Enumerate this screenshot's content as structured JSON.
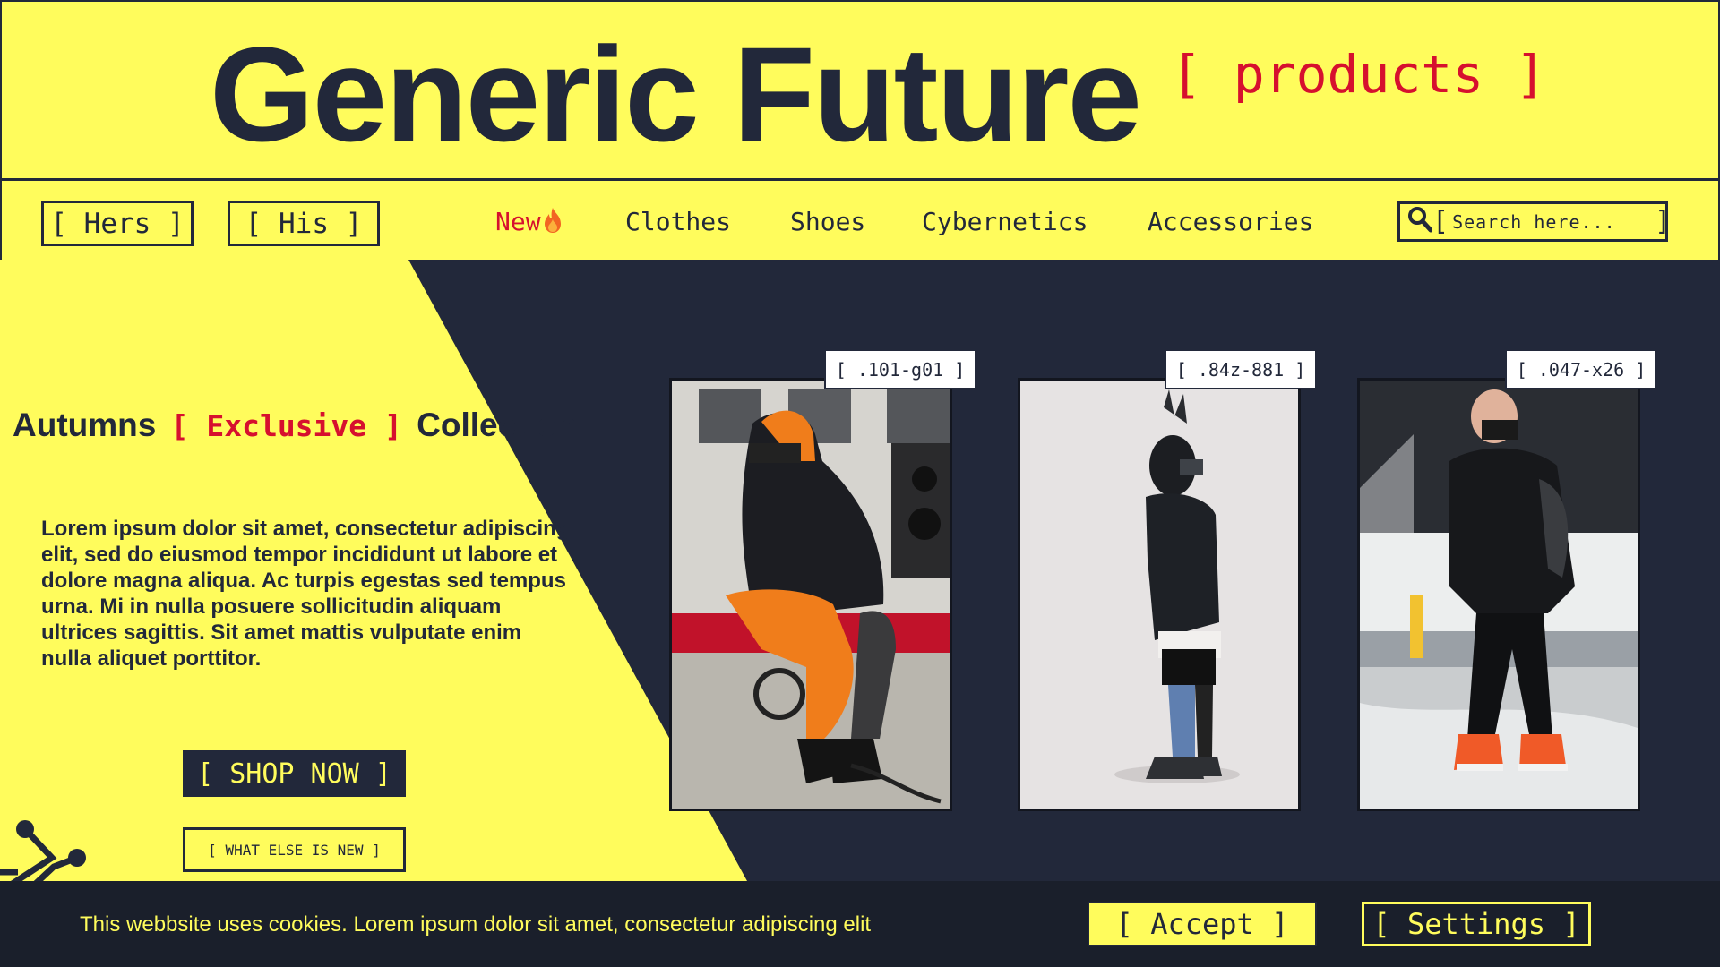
{
  "colors": {
    "accent_yellow": "#fffc5c",
    "navy": "#22283a",
    "red": "#d6102e",
    "cookie_bg": "#1a1f2b"
  },
  "header": {
    "title": "Generic Future",
    "tag": "[ products ]"
  },
  "nav": {
    "hers": "[ Hers ]",
    "his": "[ His ]",
    "links": [
      "New",
      "Clothes",
      "Shoes",
      "Cybernetics",
      "Accessories"
    ],
    "new_icon": "fire-icon",
    "search_icon": "search-icon",
    "search_open": "[",
    "search_close": "]",
    "search_placeholder": "Search here..."
  },
  "hero": {
    "title_pre": "Autumns",
    "title_tag": "[ Exclusive ]",
    "title_post": "Collection",
    "text": "Lorem ipsum dolor sit amet, consectetur adipiscing elit, sed do eiusmod tempor incididunt ut labore et dolore magna aliqua. Ac turpis egestas sed tempus urna. Mi in nulla posuere sollicitudin aliquam ultrices sagittis. Sit amet mattis vulputate enim nulla aliquet porttitor.",
    "shop_now": "[ SHOP NOW ]",
    "what_else": "[ WHAT ELSE IS NEW ]"
  },
  "products": [
    {
      "sku": "[ .101-g01 ]"
    },
    {
      "sku": "[ .84z-881 ]"
    },
    {
      "sku": "[ .047-x26 ]"
    }
  ],
  "cookie": {
    "text": "This webbsite uses cookies. Lorem ipsum dolor sit amet, consectetur adipiscing elit",
    "accept": "[ Accept ]",
    "settings": "[ Settings ]"
  }
}
